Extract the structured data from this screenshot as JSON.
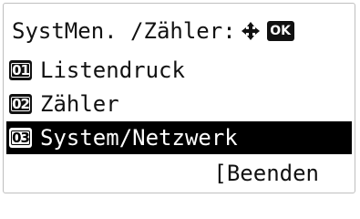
{
  "screen": {
    "title": "SystMen. /Zähler:",
    "ok_label": "OK",
    "items": [
      {
        "number": "01",
        "label": "Listendruck"
      },
      {
        "number": "02",
        "label": "Zähler"
      },
      {
        "number": "03",
        "label": "System/Netzwerk"
      }
    ],
    "selected_item": "03",
    "footer_label": "[Beenden"
  },
  "colors": {
    "highlight": "#000000",
    "text": "#111111",
    "background": "#ffffff",
    "border": "#bfbfbf"
  }
}
